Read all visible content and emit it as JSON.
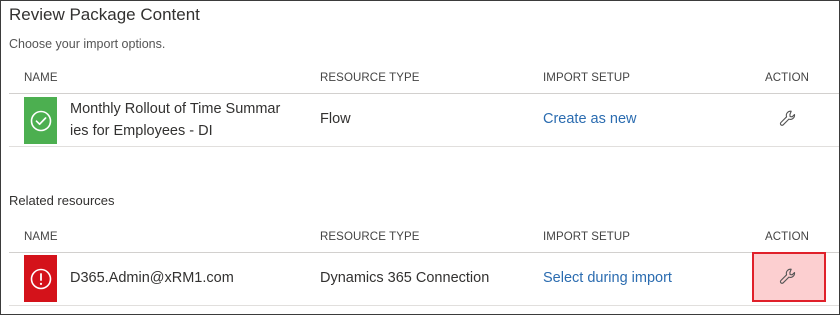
{
  "page": {
    "title": "Review Package Content",
    "subtitle": "Choose your import options."
  },
  "columns": {
    "name": "NAME",
    "resource_type": "RESOURCE TYPE",
    "import_setup": "IMPORT SETUP",
    "action": "ACTION"
  },
  "main_rows": [
    {
      "status": "success",
      "name_line1": "Monthly Rollout of Time Summar",
      "name_line2": "ies for Employees - DI",
      "resource_type": "Flow",
      "import_setup": "Create as new",
      "action_icon": "wrench-icon"
    }
  ],
  "related": {
    "label": "Related resources",
    "rows": [
      {
        "status": "error",
        "name": "D365.Admin@xRM1.com",
        "resource_type": "Dynamics 365 Connection",
        "import_setup": "Select during import",
        "action_icon": "wrench-icon"
      }
    ]
  },
  "colors": {
    "success": "#4caf50",
    "error": "#d4121a",
    "link": "#2b6cb0",
    "highlight_border": "#e0202a",
    "highlight_fill": "#fccfd0"
  }
}
